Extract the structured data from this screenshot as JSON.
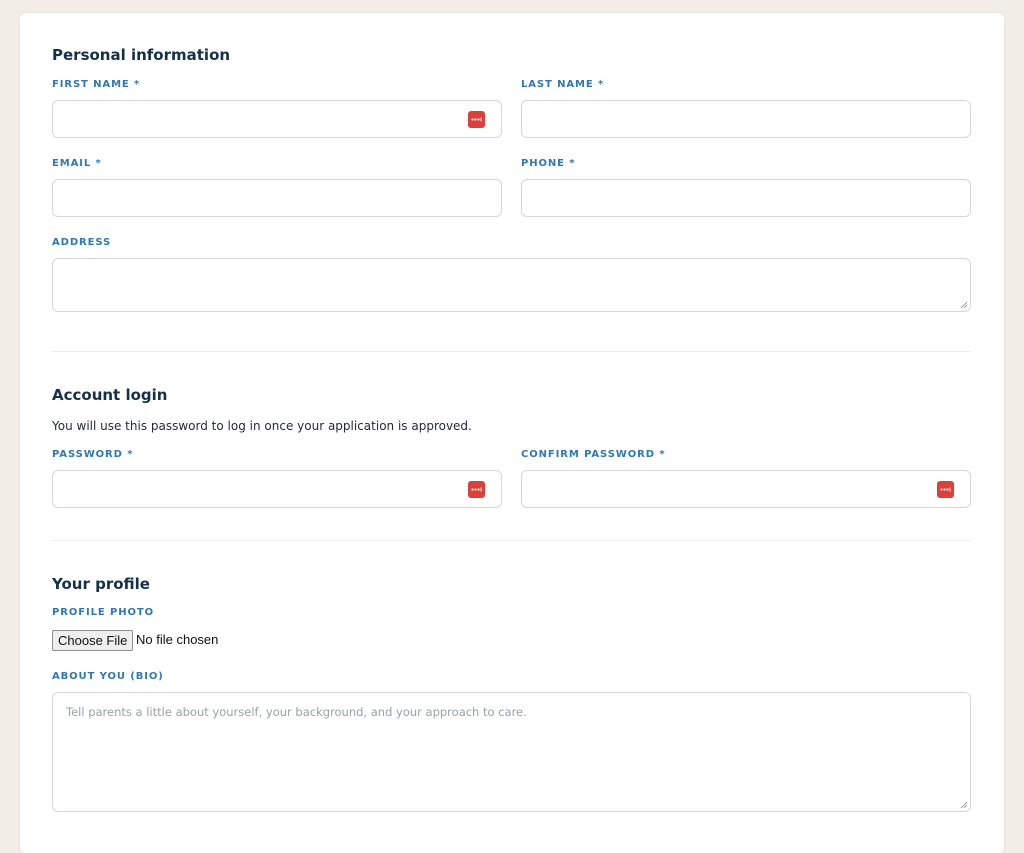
{
  "personal": {
    "title": "Personal information",
    "first_name_label": "FIRST NAME *",
    "last_name_label": "LAST NAME *",
    "email_label": "EMAIL *",
    "phone_label": "PHONE *",
    "address_label": "ADDRESS"
  },
  "account": {
    "title": "Account login",
    "helper": "You will use this password to log in once your application is approved.",
    "password_label": "PASSWORD *",
    "confirm_label": "CONFIRM PASSWORD *"
  },
  "profile": {
    "title": "Your profile",
    "photo_label": "PROFILE PHOTO",
    "choose_file": "Choose File",
    "no_file": "No file chosen",
    "bio_label": "ABOUT YOU (BIO)",
    "bio_placeholder": "Tell parents a little about yourself, your background, and your approach to care."
  },
  "colors": {
    "page_bg": "#f2ede6",
    "heading": "#14304a",
    "label": "#2f78b3",
    "password_manager_icon": "#d9413a"
  },
  "icons": {
    "password_manager": "password-manager-icon",
    "resize": "resize-grip-icon"
  }
}
